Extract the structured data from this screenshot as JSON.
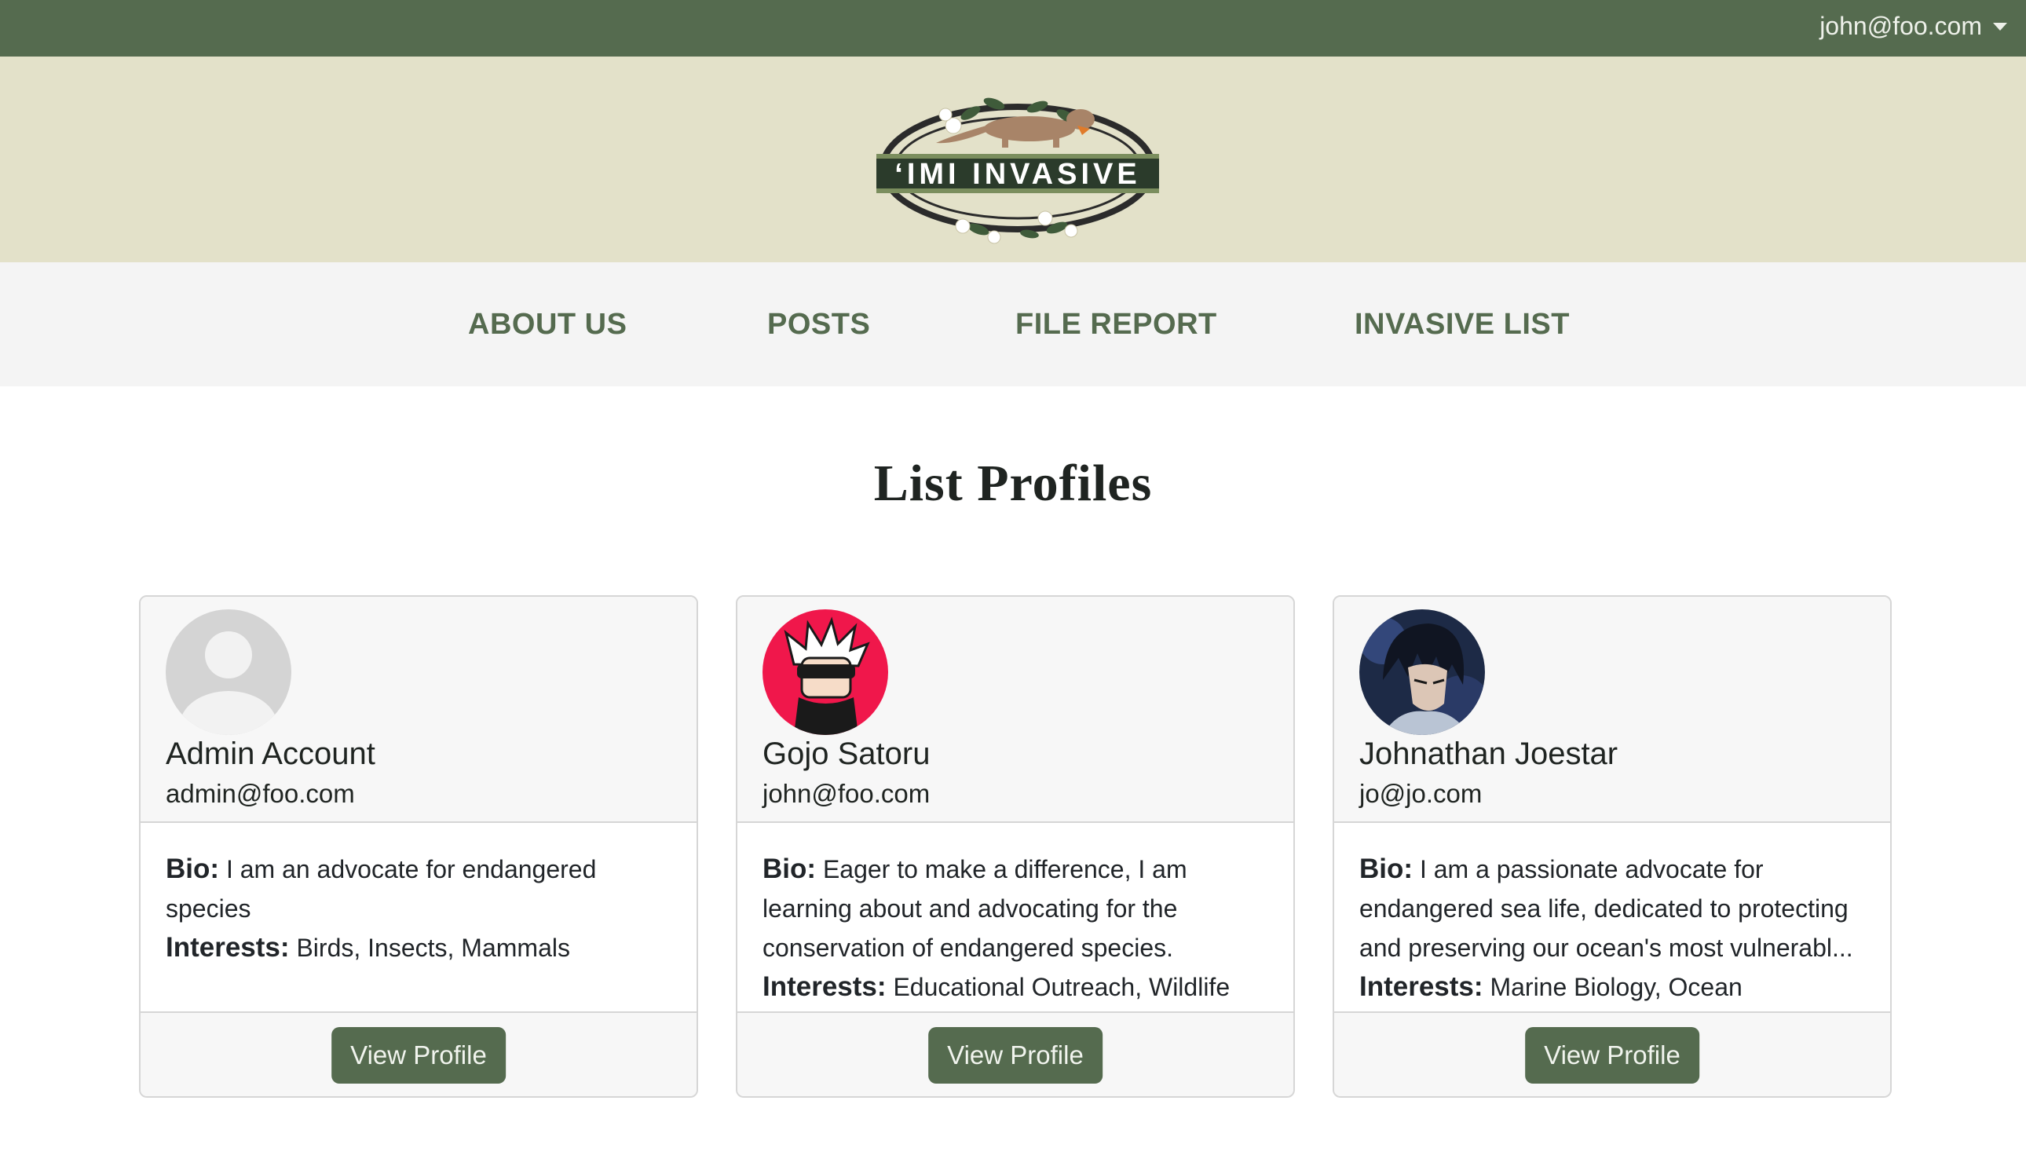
{
  "topbar": {
    "user_email": "john@foo.com",
    "bg": "#556b4f"
  },
  "banner": {
    "logo_text": "‘IMI INVASIVE",
    "bg": "#e3e1c9"
  },
  "nav": {
    "items": [
      "ABOUT US",
      "POSTS",
      "FILE REPORT",
      "INVASIVE LIST"
    ]
  },
  "page": {
    "title": "List Profiles"
  },
  "labels": {
    "bio": "Bio:",
    "interests": "Interests:",
    "view_profile": "View Profile"
  },
  "profiles": [
    {
      "name": "Admin Account",
      "email": "admin@foo.com",
      "bio": "I am an advocate for endangered species",
      "interests": "Birds, Insects, Mammals",
      "avatar": "default-avatar-icon"
    },
    {
      "name": "Gojo Satoru",
      "email": "john@foo.com",
      "bio": "Eager to make a difference, I am learning about and advocating for the conservation of endangered species.",
      "interests": "Educational Outreach, Wildlife",
      "avatar": "anime-character-avatar"
    },
    {
      "name": "Johnathan Joestar",
      "email": "jo@jo.com",
      "bio": "I am a passionate advocate for endangered sea life, dedicated to protecting and preserving our ocean's most vulnerabl...",
      "interests": "Marine Biology, Ocean",
      "avatar": "anime-character-avatar"
    }
  ],
  "colors": {
    "accent": "#556b4f",
    "card_border": "#d6d6d6",
    "gojo_avatar_bg": "#f0174b"
  }
}
